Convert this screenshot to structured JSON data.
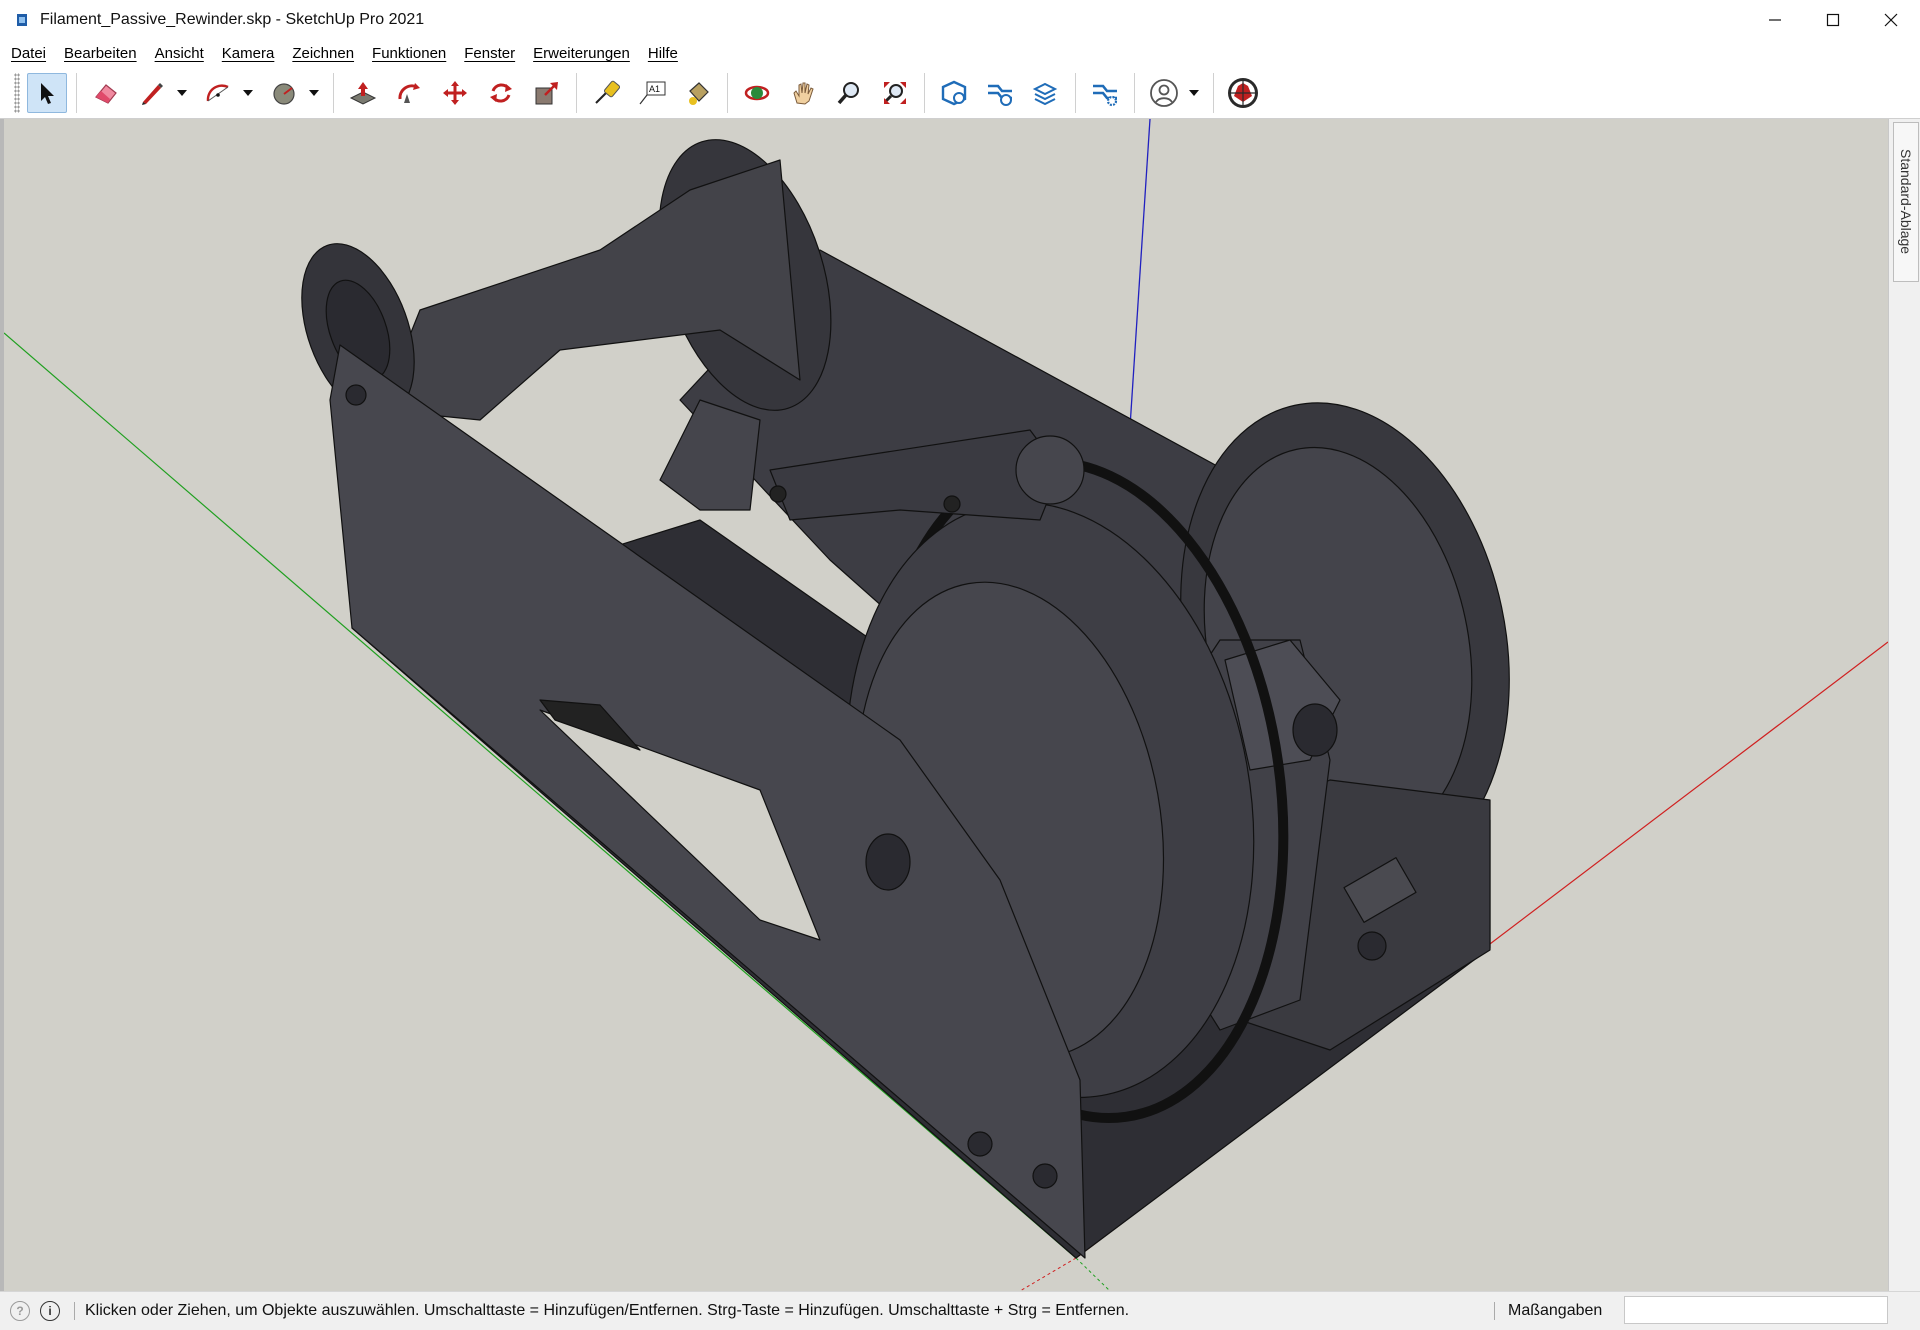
{
  "window": {
    "title": "Filament_Passive_Rewinder.skp - SketchUp Pro 2021",
    "controls": [
      "minimize",
      "maximize",
      "close"
    ]
  },
  "menu": [
    {
      "label": "Datei"
    },
    {
      "label": "Bearbeiten"
    },
    {
      "label": "Ansicht"
    },
    {
      "label": "Kamera"
    },
    {
      "label": "Zeichnen"
    },
    {
      "label": "Funktionen"
    },
    {
      "label": "Fenster"
    },
    {
      "label": "Erweiterungen"
    },
    {
      "label": "Hilfe"
    }
  ],
  "toolbar": {
    "tools": [
      {
        "name": "select-tool",
        "icon": "cursor-arrow",
        "active": true
      },
      {
        "name": "eraser-tool",
        "icon": "eraser"
      },
      {
        "name": "line-tool",
        "icon": "pencil",
        "dropdown": true
      },
      {
        "name": "arc-tool",
        "icon": "arc",
        "dropdown": true
      },
      {
        "name": "shape-tool",
        "icon": "circle-shape",
        "dropdown": true
      },
      {
        "name": "push-pull-tool",
        "icon": "push-pull"
      },
      {
        "name": "offset-tool",
        "icon": "follow-me"
      },
      {
        "name": "move-tool",
        "icon": "move-arrows"
      },
      {
        "name": "rotate-tool",
        "icon": "rotate"
      },
      {
        "name": "scale-tool",
        "icon": "scale"
      },
      {
        "name": "tape-measure-tool",
        "icon": "tape-measure"
      },
      {
        "name": "text-tool",
        "icon": "text-a1"
      },
      {
        "name": "paint-bucket-tool",
        "icon": "paint-bucket"
      },
      {
        "name": "orbit-tool",
        "icon": "orbit"
      },
      {
        "name": "pan-tool",
        "icon": "hand"
      },
      {
        "name": "zoom-tool",
        "icon": "magnifier"
      },
      {
        "name": "zoom-extents-tool",
        "icon": "zoom-extents"
      },
      {
        "name": "3d-warehouse-button",
        "icon": "warehouse"
      },
      {
        "name": "extension-warehouse-button",
        "icon": "extension-warehouse"
      },
      {
        "name": "layout-button",
        "icon": "layout"
      },
      {
        "name": "extension-manager-button",
        "icon": "extension-manager"
      },
      {
        "name": "account-button",
        "icon": "user-circle",
        "dropdown": true
      },
      {
        "name": "trimble-connect-button",
        "icon": "globe"
      }
    ]
  },
  "tray": {
    "tab_label": "Standard-Ablage"
  },
  "statusbar": {
    "hint": "Klicken oder Ziehen, um Objekte auszuwählen. Umschalttaste = Hinzufügen/Entfernen. Strg-Taste = Hinzufügen. Umschalttaste + Strg = Entfernen.",
    "measure_label": "Maßangaben",
    "measure_value": ""
  },
  "colors": {
    "viewport_background": "#d1d0c9",
    "model_dark": "#44444a",
    "axis_red": "#d02020",
    "axis_green": "#20a020",
    "axis_blue": "#2020c0",
    "toolbar_active": "#cfe4f7"
  }
}
